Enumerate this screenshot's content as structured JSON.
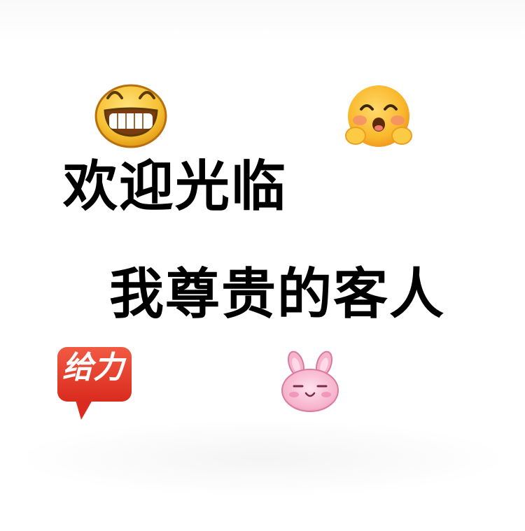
{
  "headline": {
    "line1": "欢迎光临",
    "line2": "我尊贵的客人"
  },
  "stickers": {
    "geili_label": "给力"
  },
  "icons": {
    "top_left": "grinning-face-icon",
    "top_right": "blushing-face-icon",
    "bottom_left": "geili-speech-bubble-icon",
    "bottom_right": "pink-bunny-icon"
  },
  "colors": {
    "text": "#000000",
    "emoji_yellow": "#f7c133",
    "geili_red": "#e8392c",
    "bunny_pink": "#f6b3cc"
  }
}
